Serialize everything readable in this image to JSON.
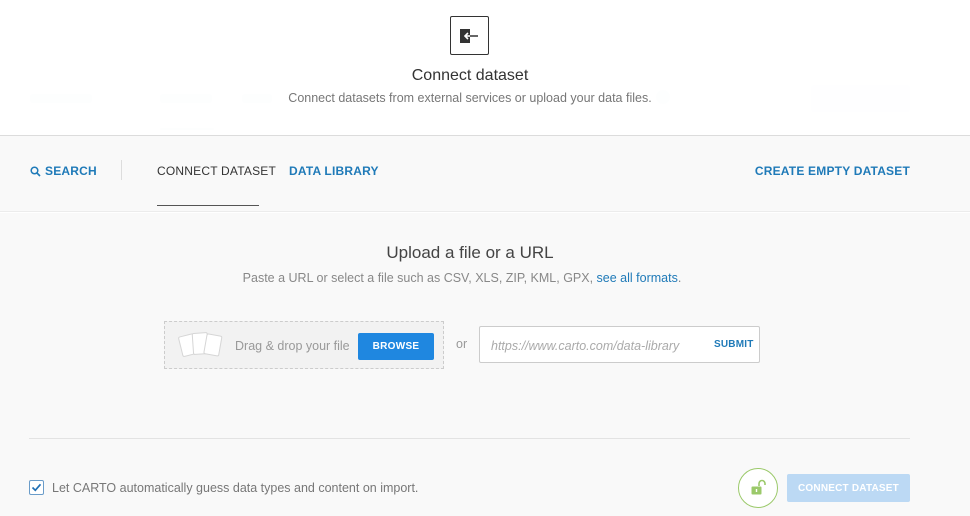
{
  "modal": {
    "title": "Connect dataset",
    "subtitle": "Connect datasets from external services or upload your data files."
  },
  "tabs": {
    "search_label": "SEARCH",
    "connect_label": "CONNECT DATASET",
    "library_label": "DATA LIBRARY",
    "create_label": "CREATE EMPTY DATASET"
  },
  "upload": {
    "title": "Upload a file or a URL",
    "description": "Paste a URL or select a file such as CSV, XLS, ZIP, KML, GPX,",
    "formats_link": "see all formats",
    "period": ".",
    "drop_text": "Drag & drop your file",
    "browse_label": "BROWSE",
    "or_text": "or",
    "url_placeholder": "https://www.carto.com/data-library",
    "url_value": "",
    "submit_label": "SUBMIT"
  },
  "footer": {
    "guess_label": "Let CARTO automatically guess data types and content on import.",
    "guess_checked": true,
    "connect_label": "CONNECT DATASET"
  },
  "icons": {
    "header": "connect-dataset-icon",
    "search": "search-icon",
    "files": "files-icon",
    "check": "checkmark-icon",
    "privacy": "unlock-icon"
  },
  "colors": {
    "accent": "#1f7ab8",
    "button": "#1f87e0",
    "button_disabled": "#bcd9f4",
    "privacy": "#9bc96a"
  }
}
